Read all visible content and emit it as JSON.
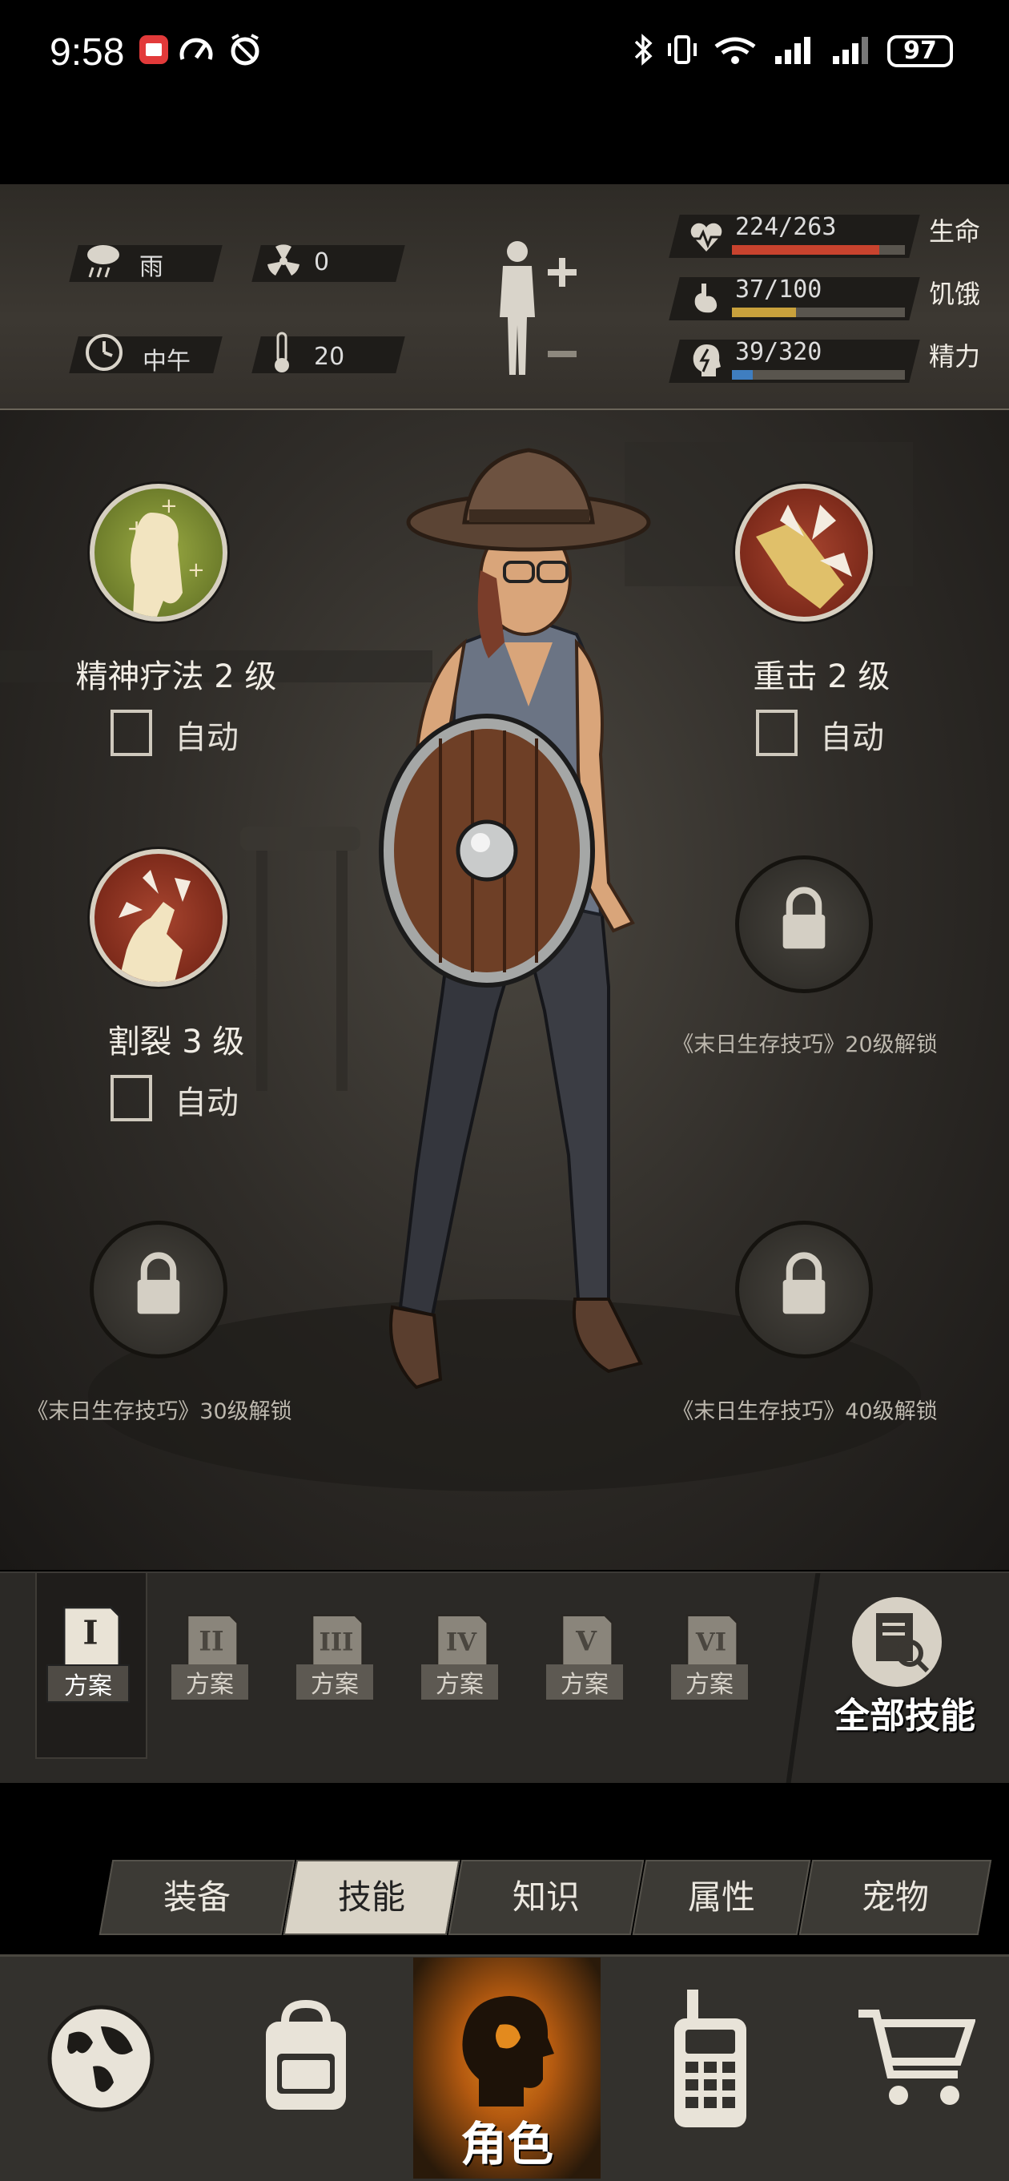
{
  "status_bar": {
    "time": "9:58",
    "battery": "97"
  },
  "hud": {
    "weather": {
      "label": "雨",
      "icon": "rain-cloud-icon"
    },
    "radiation": {
      "value": "0",
      "icon": "radiation-icon"
    },
    "time_of_day": {
      "label": "中午",
      "icon": "clock-icon"
    },
    "temperature": {
      "value": "20",
      "icon": "thermometer-icon"
    },
    "stats": [
      {
        "name": "生命",
        "text": "224/263",
        "current": 224,
        "max": 263,
        "color": "#c8432e",
        "icon": "heart-rate-icon"
      },
      {
        "name": "饥饿",
        "text": "37/100",
        "current": 37,
        "max": 100,
        "color": "#c9a13c",
        "icon": "stomach-icon"
      },
      {
        "name": "精力",
        "text": "39/320",
        "current": 39,
        "max": 320,
        "color": "#3f7ec0",
        "icon": "head-energy-icon"
      }
    ]
  },
  "skills": {
    "auto_label": "自动",
    "slot1": {
      "name": "精神疗法 2 级",
      "icon": "spirit-therapy-icon"
    },
    "slot2": {
      "name": "重击 2 级",
      "icon": "heavy-strike-icon"
    },
    "slot3": {
      "name": "割裂 3 级",
      "icon": "laceration-icon"
    },
    "locked": [
      {
        "text": "《末日生存技巧》20级解锁"
      },
      {
        "text": "《末日生存技巧》30级解锁"
      },
      {
        "text": "《末日生存技巧》40级解锁"
      }
    ]
  },
  "schemes": {
    "label": "方案",
    "numerals": [
      "I",
      "II",
      "III",
      "IV",
      "V",
      "VI"
    ],
    "all_skills": "全部技能"
  },
  "tabs": [
    "装备",
    "技能",
    "知识",
    "属性",
    "宠物"
  ],
  "bottom_nav": {
    "character": "角色"
  }
}
